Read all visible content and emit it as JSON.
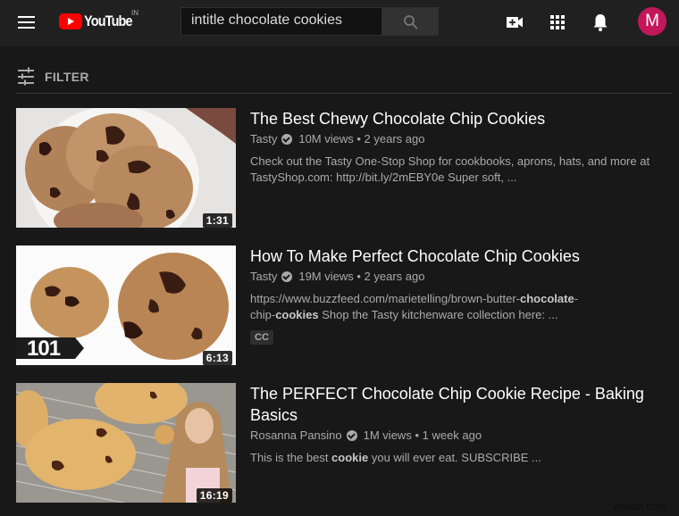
{
  "header": {
    "logo_text": "YouTube",
    "logo_country": "IN",
    "search_value": "intitle chocolate cookies",
    "avatar_letter": "M",
    "avatar_color": "#c2185b",
    "icons": [
      "menu-icon",
      "search-icon",
      "create-video-icon",
      "apps-grid-icon",
      "notifications-bell-icon"
    ]
  },
  "filter": {
    "label": "FILTER"
  },
  "results": [
    {
      "title": "The Best Chewy Chocolate Chip Cookies",
      "channel": "Tasty",
      "verified": true,
      "views": "10M views",
      "age": "2 years ago",
      "description_line1": "Check out the Tasty One-Stop Shop for cookbooks, aprons, hats, and more at",
      "description_line2": "TastyShop.com: http://bit.ly/2mEBY0e Super soft, ...",
      "duration": "1:31"
    },
    {
      "title": "How To Make Perfect Chocolate Chip Cookies",
      "channel": "Tasty",
      "verified": true,
      "views": "19M views",
      "age": "2 years ago",
      "description_parts": [
        {
          "text": "https://www.buzzfeed.com/marietelling/brown-butter-",
          "bold": false
        },
        {
          "text": "chocolate",
          "bold": true
        },
        {
          "text": "-",
          "bold": false
        },
        {
          "text": "chip-",
          "bold": false
        },
        {
          "text": "cookies",
          "bold": true
        },
        {
          "text": " Shop the Tasty kitchenware collection here: ...",
          "bold": false
        }
      ],
      "badge": "CC",
      "duration": "6:13",
      "thumb_overlay": "101"
    },
    {
      "title": "The PERFECT Chocolate Chip Cookie Recipe - Baking Basics",
      "channel": "Rosanna Pansino",
      "verified": true,
      "views": "1M views",
      "age": "1 week ago",
      "description_parts": [
        {
          "text": "This is the best ",
          "bold": false
        },
        {
          "text": "cookie",
          "bold": true
        },
        {
          "text": " you will ever eat. SUBSCRIBE ...",
          "bold": false
        }
      ],
      "duration": "16:19"
    }
  ],
  "watermark": "wsxdn.com"
}
